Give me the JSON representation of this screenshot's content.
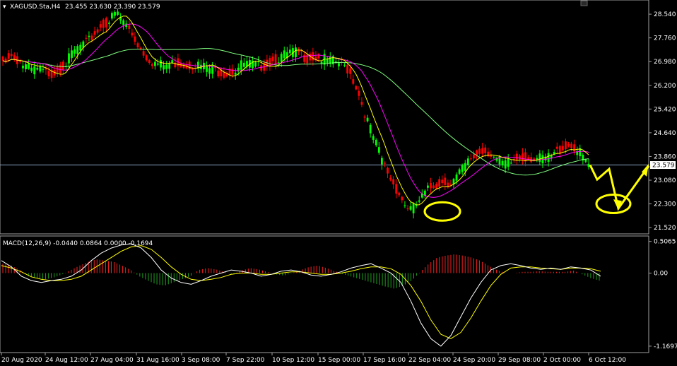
{
  "chart_data": [
    {
      "type": "candlestick",
      "symbol_header": "XAGUSD.Sta,H4",
      "ohlc_header": "23.455 23.630 23.390 23.579",
      "current_price_label": "23.579",
      "current_price": 23.579,
      "y_ticks": [
        "28.540",
        "27.760",
        "26.980",
        "26.200",
        "25.420",
        "24.640",
        "23.860",
        "23.080",
        "22.300",
        "21.520"
      ],
      "ylim": [
        21.36,
        28.96
      ],
      "x_ticks": [
        "20 Aug 2020",
        "24 Aug 12:00",
        "27 Aug 04:00",
        "31 Aug 16:00",
        "3 Sep 08:00",
        "7 Sep 22:00",
        "10 Sep 12:00",
        "15 Sep 00:00",
        "17 Sep 16:00",
        "22 Sep 04:00",
        "24 Sep 20:00",
        "29 Sep 08:00",
        "2 Oct 00:00",
        "6 Oct 12:00"
      ],
      "colors": {
        "bull": "#00ff00",
        "bear": "#ff0000",
        "ma_fast": "#ffff00",
        "ma_mid": "#ff00ff",
        "ma_slow": "#7fff7f",
        "price_line": "#8fa6c8",
        "annotation": "#ffff00"
      },
      "price_path": [
        26.98,
        27.2,
        27.05,
        26.85,
        26.7,
        26.72,
        26.6,
        26.6,
        26.75,
        26.95,
        27.3,
        27.5,
        27.6,
        27.9,
        28.15,
        28.3,
        28.6,
        28.35,
        28.0,
        27.6,
        27.25,
        27.0,
        26.9,
        26.85,
        26.92,
        26.95,
        26.85,
        26.9,
        26.85,
        26.78,
        26.7,
        26.62,
        26.6,
        26.72,
        26.92,
        26.9,
        26.82,
        26.85,
        26.98,
        27.1,
        27.2,
        27.3,
        27.25,
        27.1,
        27.12,
        27.1,
        27.02,
        26.98,
        26.9,
        26.7,
        26.2,
        25.5,
        24.8,
        24.2,
        23.6,
        23.1,
        22.7,
        22.25,
        22.1,
        22.4,
        22.7,
        22.9,
        23.0,
        23.0,
        23.1,
        23.4,
        23.7,
        23.9,
        24.05,
        24.0,
        23.75,
        23.6,
        23.65,
        23.8,
        23.85,
        23.82,
        23.78,
        23.8,
        23.9,
        24.1,
        24.25,
        24.15,
        23.9,
        23.58
      ],
      "annotations": {
        "forecast_path": [
          23.58,
          23.1,
          23.45,
          22.15,
          23.55
        ],
        "circles": [
          "22 Sep low",
          "projected low"
        ]
      }
    },
    {
      "type": "macd",
      "header": "MACD(12,26,9) -0.0440 0.0864 0.0000 -0.1694",
      "y_ticks": [
        "0.5065",
        "0.00",
        "-1.1697"
      ],
      "ylim": [
        -1.25,
        0.56
      ],
      "histogram": [
        0.15,
        0.12,
        0.05,
        -0.05,
        -0.08,
        -0.1,
        -0.07,
        -0.02,
        0.05,
        0.12,
        0.18,
        0.22,
        0.2,
        0.18,
        0.12,
        0.05,
        -0.05,
        -0.12,
        -0.18,
        -0.2,
        -0.15,
        -0.1,
        -0.05,
        0.05,
        0.08,
        0.06,
        0.02,
        -0.02,
        0.04,
        0.08,
        0.06,
        0.02,
        -0.02,
        -0.04,
        0.0,
        0.05,
        0.1,
        0.12,
        0.08,
        0.03,
        -0.02,
        -0.06,
        -0.1,
        -0.14,
        -0.18,
        -0.22,
        -0.25,
        -0.2,
        -0.12,
        0.02,
        0.15,
        0.25,
        0.28,
        0.3,
        0.28,
        0.25,
        0.2,
        0.12,
        0.05,
        0.0,
        0.0,
        0.02,
        0.02,
        0.03,
        0.02,
        0.02,
        0.02,
        0.04,
        -0.02,
        -0.08,
        -0.12
      ],
      "macd_line": [
        0.2,
        0.1,
        -0.05,
        -0.12,
        -0.15,
        -0.12,
        -0.1,
        -0.05,
        0.05,
        0.2,
        0.32,
        0.4,
        0.45,
        0.47,
        0.4,
        0.25,
        0.05,
        -0.08,
        -0.15,
        -0.18,
        -0.12,
        -0.05,
        0.0,
        0.05,
        0.03,
        0.0,
        -0.05,
        -0.02,
        0.03,
        0.05,
        0.02,
        -0.03,
        -0.05,
        -0.02,
        0.02,
        0.08,
        0.12,
        0.15,
        0.08,
        0.0,
        -0.15,
        -0.45,
        -0.8,
        -1.05,
        -1.17,
        -1.0,
        -0.7,
        -0.4,
        -0.15,
        0.05,
        0.12,
        0.15,
        0.12,
        0.08,
        0.06,
        0.08,
        0.06,
        0.1,
        0.08,
        0.05,
        -0.05
      ],
      "signal_line": [
        0.12,
        0.08,
        0.02,
        -0.06,
        -0.1,
        -0.12,
        -0.12,
        -0.1,
        -0.05,
        0.05,
        0.15,
        0.25,
        0.35,
        0.42,
        0.44,
        0.38,
        0.25,
        0.1,
        -0.02,
        -0.1,
        -0.12,
        -0.1,
        -0.07,
        -0.02,
        0.0,
        0.0,
        -0.02,
        -0.02,
        0.0,
        0.02,
        0.02,
        0.0,
        -0.02,
        -0.02,
        0.0,
        0.03,
        0.07,
        0.1,
        0.1,
        0.07,
        -0.02,
        -0.2,
        -0.45,
        -0.75,
        -0.98,
        -1.05,
        -0.95,
        -0.72,
        -0.45,
        -0.2,
        -0.02,
        0.08,
        0.1,
        0.1,
        0.08,
        0.07,
        0.06,
        0.08,
        0.08,
        0.07,
        0.03
      ],
      "colors": {
        "hist_pos": "#ff2020",
        "hist_neg": "#20a020",
        "macd": "#ffffff",
        "signal": "#ffff00"
      }
    }
  ]
}
